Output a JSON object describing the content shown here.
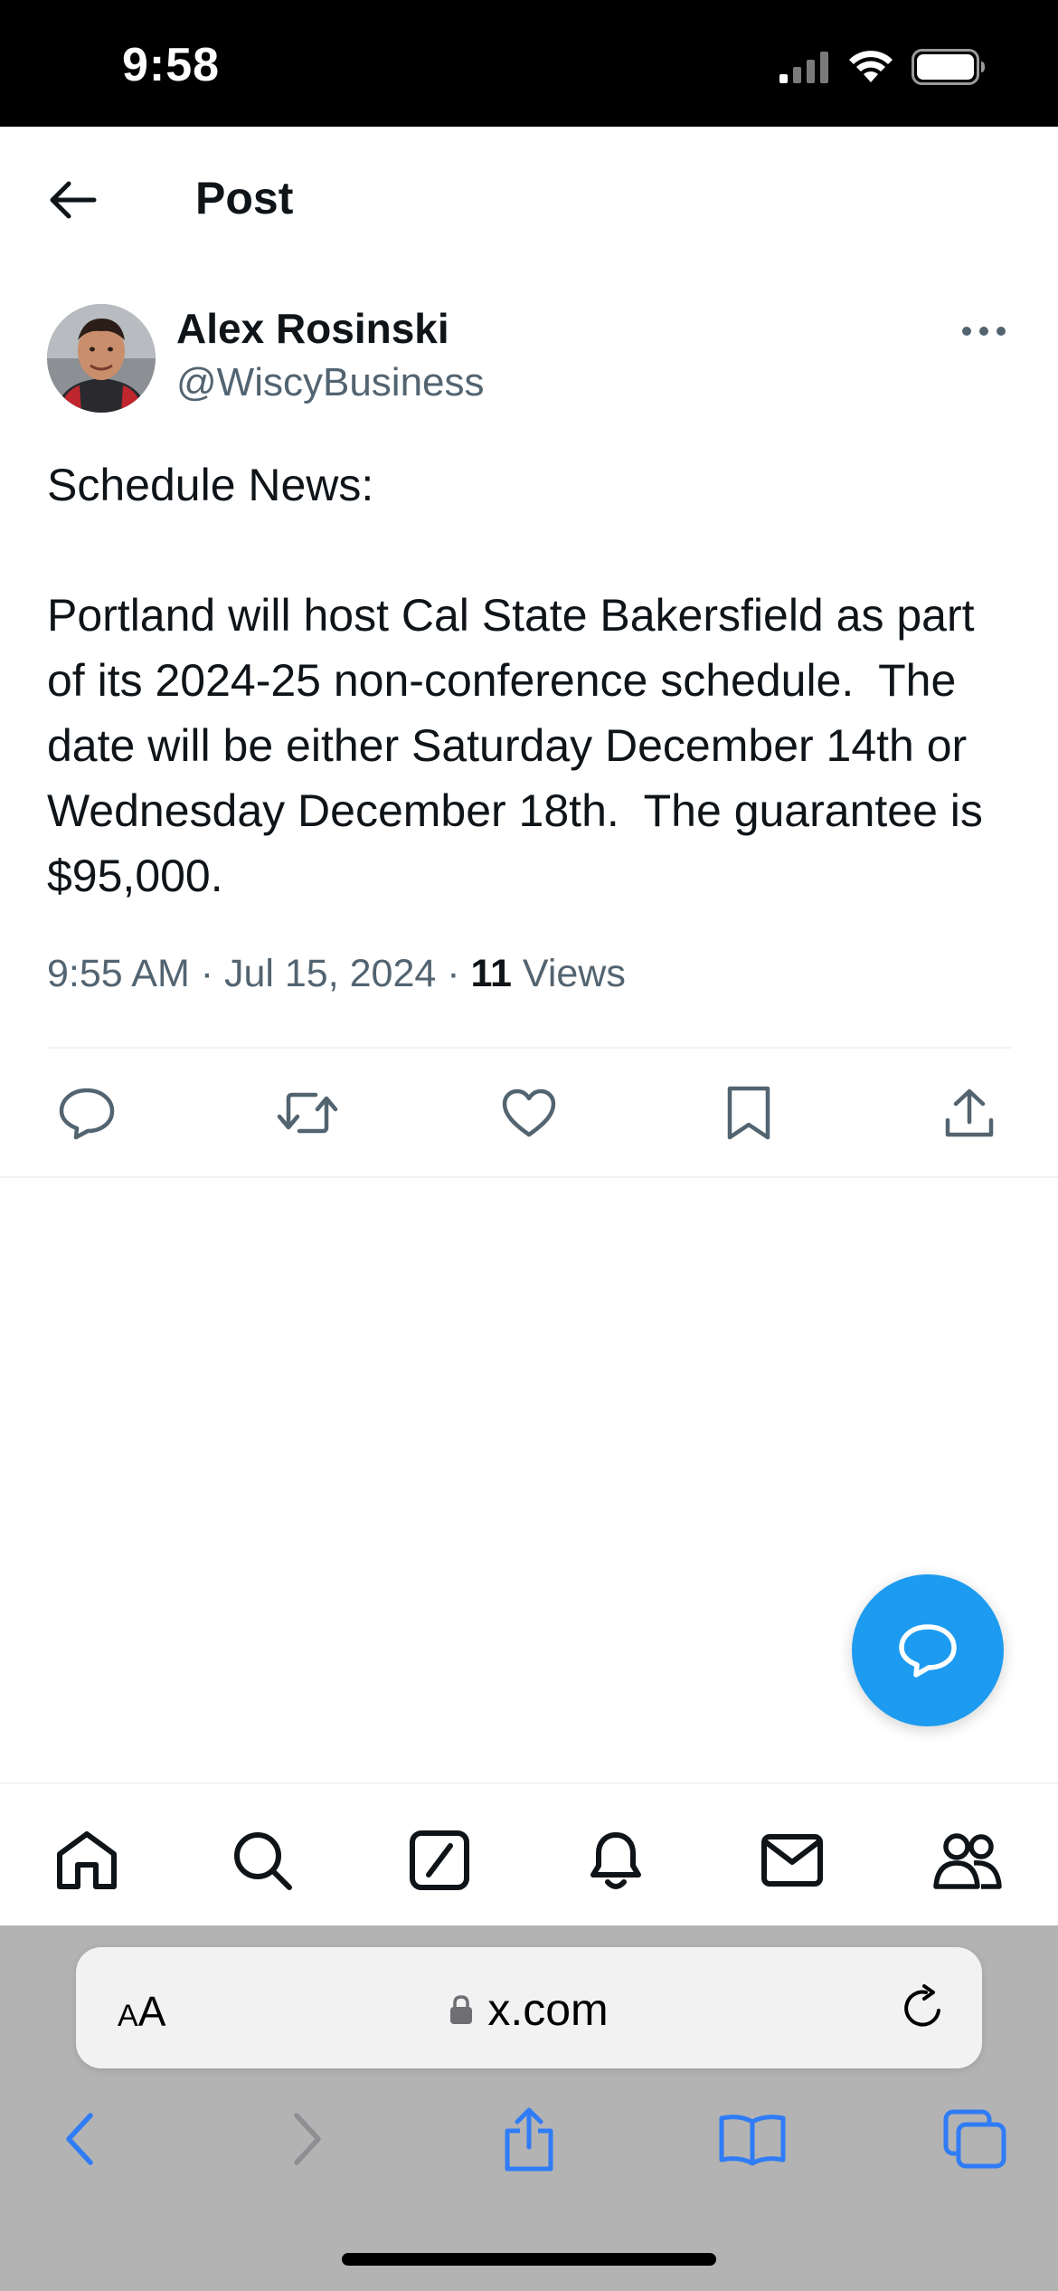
{
  "status_bar": {
    "time": "9:58"
  },
  "header": {
    "title": "Post"
  },
  "post": {
    "author_name": "Alex Rosinski",
    "author_handle": "@WiscyBusiness",
    "text": "Schedule News:\n\nPortland will host Cal State Bakersfield as part of its 2024-25 non-conference schedule.  The date will be either Saturday December 14th or Wednesday December 18th.  The guarantee is $95,000.",
    "timestamp": "9:55 AM · Jul 15, 2024 · ",
    "views_count": "11",
    "views_label": "Views"
  },
  "browser": {
    "url": "x.com",
    "text_size_label_small": "A",
    "text_size_label_large": "A"
  },
  "colors": {
    "accent": "#1d9bf0",
    "text_secondary": "#536471",
    "browser_tint": "#2f7cf6"
  },
  "icons": {
    "actions": [
      "reply-icon",
      "repost-icon",
      "like-icon",
      "bookmark-icon",
      "share-icon"
    ],
    "nav": [
      "home-icon",
      "search-icon",
      "grok-icon",
      "notifications-icon",
      "messages-icon",
      "communities-icon"
    ],
    "browser": [
      "back-icon",
      "forward-icon",
      "share-icon",
      "bookmarks-icon",
      "tabs-icon"
    ]
  }
}
